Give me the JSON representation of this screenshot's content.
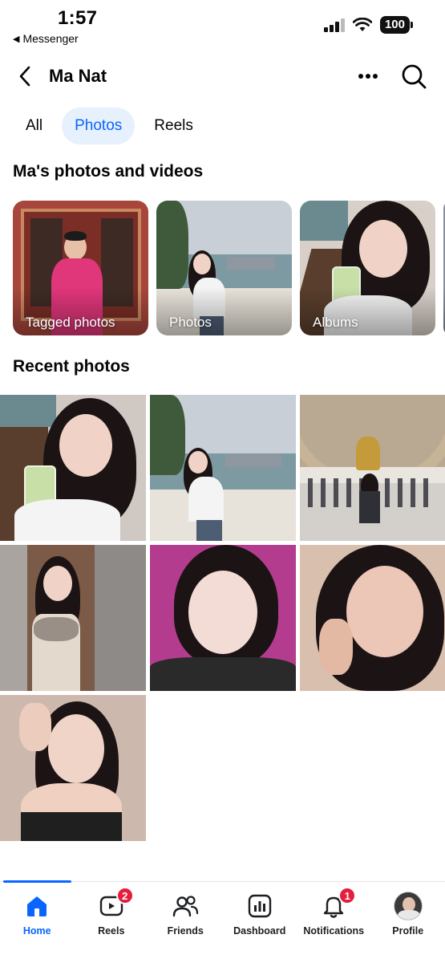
{
  "status_bar": {
    "time": "1:57",
    "back_app": "Messenger",
    "battery": "100"
  },
  "header": {
    "title": "Ma Nat"
  },
  "tabs": [
    {
      "label": "All",
      "active": false
    },
    {
      "label": "Photos",
      "active": true
    },
    {
      "label": "Reels",
      "active": false
    }
  ],
  "albums_section": {
    "title": "Ma's photos and videos",
    "albums": [
      {
        "label": "Tagged photos"
      },
      {
        "label": "Photos"
      },
      {
        "label": "Albums"
      }
    ]
  },
  "recent_section": {
    "title": "Recent photos",
    "photo_count": 7
  },
  "bottom_nav": {
    "items": [
      {
        "label": "Home",
        "icon": "home-icon",
        "active": true,
        "badge": ""
      },
      {
        "label": "Reels",
        "icon": "reels-icon",
        "active": false,
        "badge": "2"
      },
      {
        "label": "Friends",
        "icon": "friends-icon",
        "active": false,
        "badge": ""
      },
      {
        "label": "Dashboard",
        "icon": "dashboard-icon",
        "active": false,
        "badge": ""
      },
      {
        "label": "Notifications",
        "icon": "bell-icon",
        "active": false,
        "badge": "1"
      },
      {
        "label": "Profile",
        "icon": "profile-avatar",
        "active": false,
        "badge": ""
      }
    ]
  },
  "colors": {
    "accent": "#0866ff",
    "tab_active_bg": "#e7f0fd",
    "badge": "#e41e3f"
  }
}
